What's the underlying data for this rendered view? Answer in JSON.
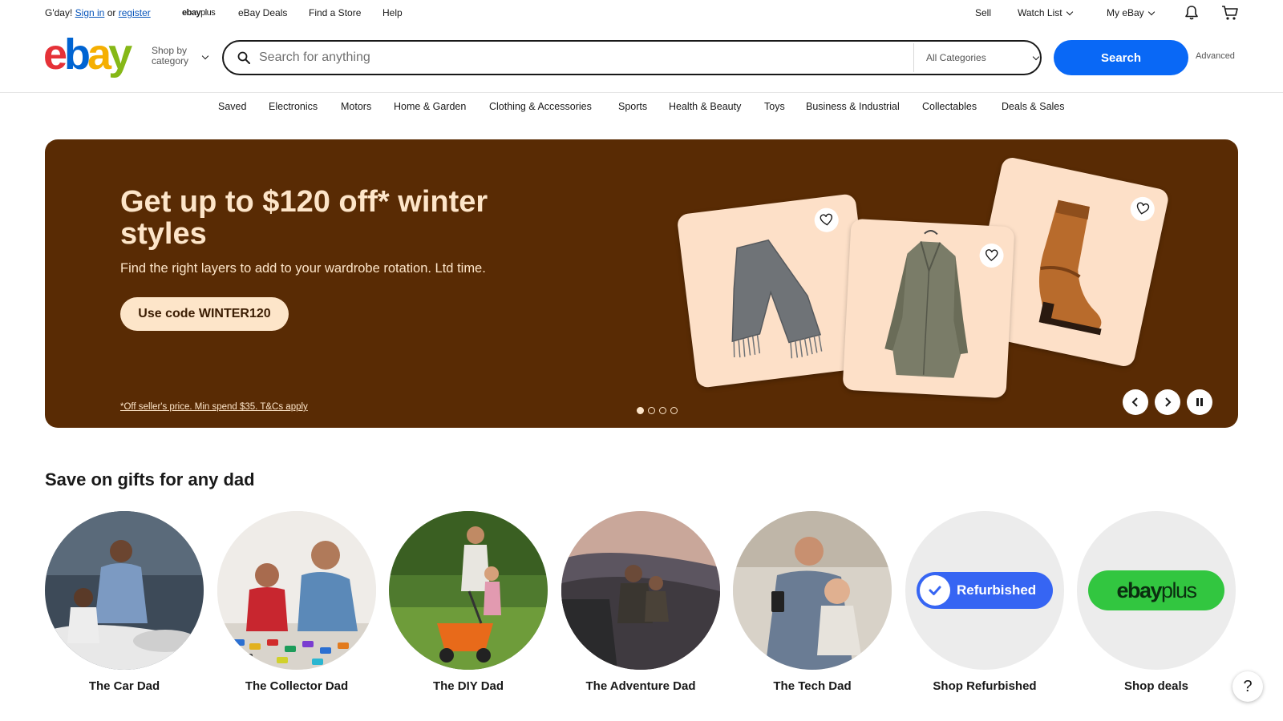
{
  "topbar": {
    "greeting": "G'day!",
    "sign_in": "Sign in",
    "or": "or",
    "register": "register",
    "ebay_plus_brand": "ebay",
    "ebay_plus_suffix": "plus",
    "deals": "eBay Deals",
    "find_store": "Find a Store",
    "help": "Help",
    "sell": "Sell",
    "watch_list": "Watch List",
    "my_ebay": "My eBay"
  },
  "header": {
    "logo": [
      "e",
      "b",
      "a",
      "y"
    ],
    "shop_by_line1": "Shop by",
    "shop_by_line2": "category",
    "search_placeholder": "Search for anything",
    "category_selected": "All Categories",
    "search_button": "Search",
    "advanced": "Advanced"
  },
  "category_nav": [
    "Saved",
    "Electronics",
    "Motors",
    "Home & Garden",
    "Clothing & Accessories",
    "Sports",
    "Health & Beauty",
    "Toys",
    "Business & Industrial",
    "Collectables",
    "Deals & Sales"
  ],
  "hero": {
    "title": "Get up to $120 off* winter styles",
    "subtitle": "Find the right layers to add to your wardrobe rotation. Ltd time.",
    "cta": "Use code WINTER120",
    "terms": "*Off seller's price. Min spend $35. T&Cs apply",
    "slide_count": 4,
    "active_slide": 1,
    "background_color": "#592b04",
    "accent_color": "#fde5c9"
  },
  "section": {
    "title": "Save on gifts for any dad",
    "tiles": [
      {
        "label": "The Car Dad"
      },
      {
        "label": "The Collector Dad"
      },
      {
        "label": "The DIY Dad"
      },
      {
        "label": "The Adventure Dad"
      },
      {
        "label": "The Tech Dad"
      },
      {
        "label": "Shop Refurbished",
        "badge": "Refurbished"
      },
      {
        "label": "Shop deals",
        "badge_brand": "ebay",
        "badge_suffix": "plus"
      }
    ]
  },
  "help_label": "?",
  "colors": {
    "primary_blue": "#0968f6",
    "link_blue": "#0654ba"
  }
}
